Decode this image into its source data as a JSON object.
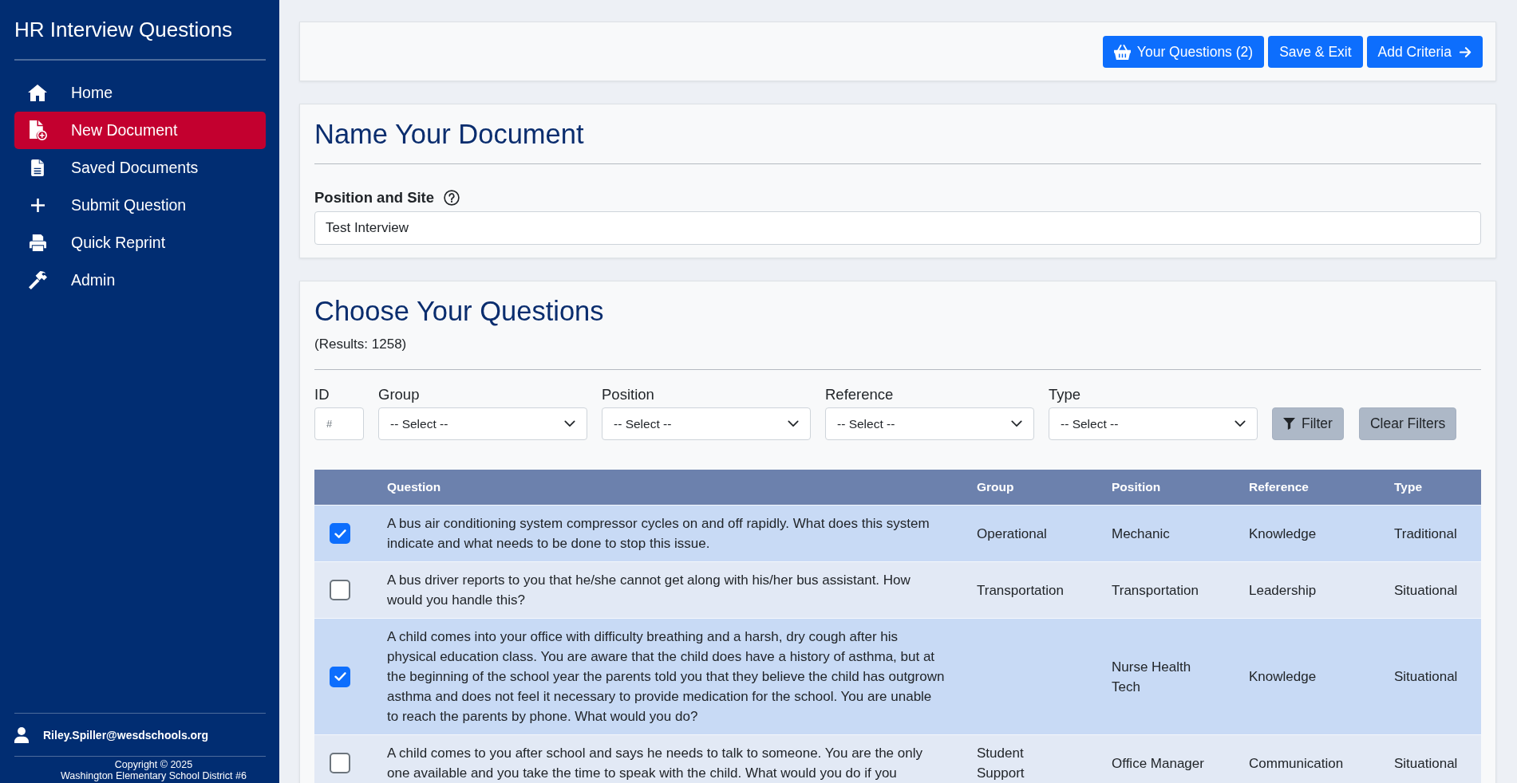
{
  "sidebar": {
    "title": "HR Interview Questions",
    "items": [
      {
        "label": "Home",
        "selected": false
      },
      {
        "label": "New Document",
        "selected": true
      },
      {
        "label": "Saved Documents",
        "selected": false
      },
      {
        "label": "Submit Question",
        "selected": false
      },
      {
        "label": "Quick Reprint",
        "selected": false
      },
      {
        "label": "Admin",
        "selected": false
      }
    ],
    "user": "Riley.Spiller@wesdschools.org",
    "copyright": [
      "Copyright © 2025",
      "Washington Elementary School District #6"
    ]
  },
  "toolbar": {
    "buttons": [
      "Your Questions (2)",
      "Save & Exit",
      "Add Criteria"
    ]
  },
  "name_document": {
    "heading": "Name Your Document",
    "field": {
      "label": "Position and Site",
      "value": "Test Interview"
    }
  },
  "questions": {
    "heading": "Choose Your Questions",
    "results": "(Results: 1258)",
    "filters": [
      {
        "kind": "text",
        "label": "ID",
        "placeholder": "#"
      },
      {
        "kind": "select",
        "label": "Group",
        "value": "-- Select --"
      },
      {
        "kind": "select",
        "label": "Position",
        "value": "-- Select --"
      },
      {
        "kind": "select",
        "label": "Reference",
        "value": "-- Select --"
      },
      {
        "kind": "select",
        "label": "Type",
        "value": "-- Select --"
      }
    ],
    "buttons": [
      "Filter",
      "Clear Filters"
    ],
    "table": {
      "columns": [
        "Question",
        "Group",
        "Position",
        "Reference",
        "Type"
      ],
      "rows": [
        {
          "selected": true,
          "question": "A bus air conditioning system compressor cycles on and off rapidly. What does this system indicate and what needs to be done to stop this issue.",
          "group": "Operational",
          "position": "Mechanic",
          "reference": "Knowledge",
          "type": "Traditional"
        },
        {
          "selected": false,
          "question": "A bus driver reports to you that he/she cannot get along with his/her bus assistant. How would you handle this?",
          "group": "Transportation",
          "position": "Transportation",
          "reference": "Leadership",
          "type": "Situational"
        },
        {
          "selected": true,
          "question": "A child comes into your office with difficulty breathing and a harsh, dry cough after his physical education class. You are aware that the child does have a history of asthma, but at the beginning of the school year the parents told you that they believe the child has outgrown asthma and does not feel it necessary to provide medication for the school. You are unable to reach the parents by phone. What would you do?",
          "position": "Nurse Health Tech",
          "reference": "Knowledge",
          "type": "Situational"
        },
        {
          "selected": false,
          "question": "A child comes to you after school and says he needs to talk to someone. You are the only one available and you take the time to speak with the child. What would you do if you",
          "group": "Student Support",
          "position": "Office Manager",
          "reference": "Communication",
          "type": "Situational"
        }
      ]
    }
  }
}
